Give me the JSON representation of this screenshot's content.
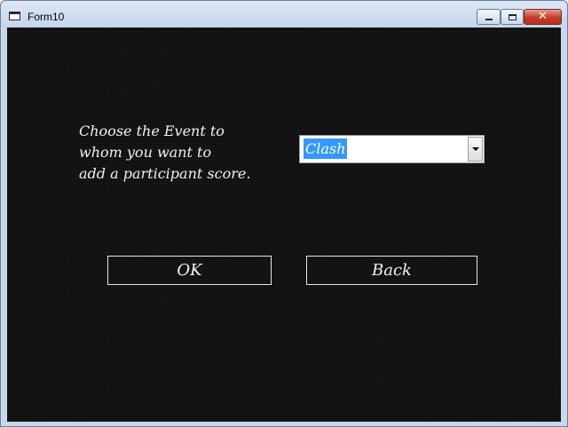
{
  "window": {
    "title": "Form10"
  },
  "titlebar": {
    "icon": "form-window-icon",
    "minimize_icon": "minimize-icon",
    "maximize_icon": "maximize-icon",
    "close_icon": "close-icon",
    "close_glyph": "✕"
  },
  "form": {
    "prompt": "Choose the Event to\nwhom you want to\nadd a participant score.",
    "event_select": {
      "selected": "Clash",
      "dropdown_icon": "chevron-down-icon"
    },
    "ok_label": "OK",
    "back_label": "Back"
  },
  "colors": {
    "background": "#111111",
    "text": "#f2f2f2",
    "selection": "#3399ff"
  }
}
